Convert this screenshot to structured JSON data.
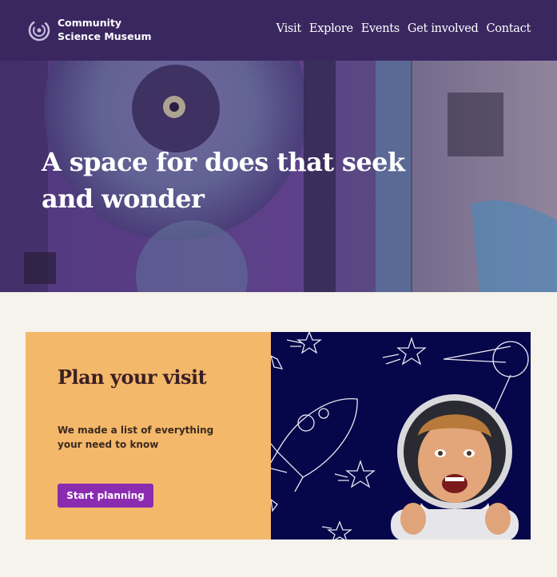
{
  "header": {
    "logo_line1": "Community",
    "logo_line2": "Science Museum",
    "nav": [
      {
        "label": "Visit"
      },
      {
        "label": "Explore"
      },
      {
        "label": "Events"
      },
      {
        "label": "Get involved"
      },
      {
        "label": "Contact"
      }
    ]
  },
  "hero": {
    "title": "A space for does that seek and wonder"
  },
  "visit_card": {
    "title": "Plan your visit",
    "description": "We made a list of everything your need to know",
    "button_label": "Start planning"
  },
  "colors": {
    "header_bg": "#3a2760",
    "card_bg": "#f4b86a",
    "button_bg": "#8b2bb0",
    "illustration_bg": "#06064a"
  }
}
